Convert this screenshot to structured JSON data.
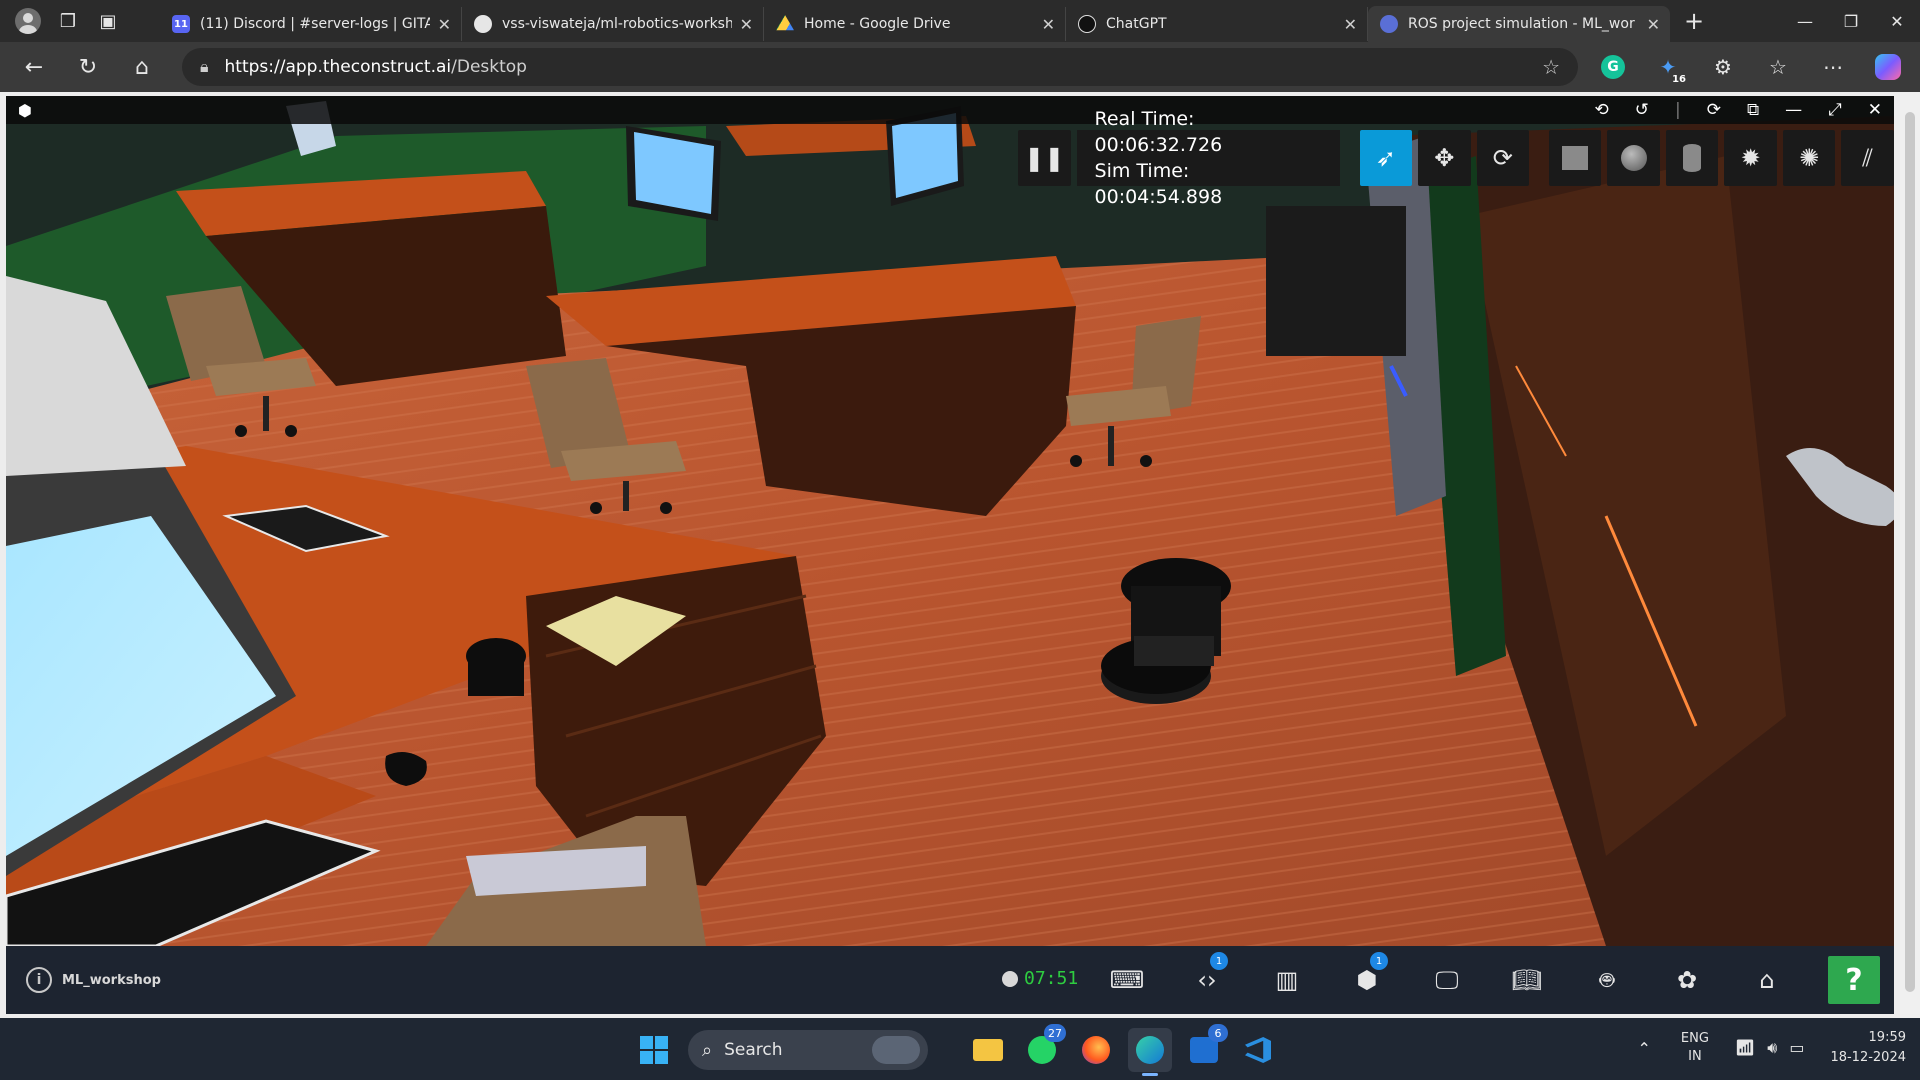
{
  "browser": {
    "tabs": [
      {
        "title": "(11) Discord | #server-logs | GITAM",
        "favicon_badge": "11",
        "active": false
      },
      {
        "title": "vss-viswateja/ml-robotics-worksh",
        "active": false
      },
      {
        "title": "Home - Google Drive",
        "active": false
      },
      {
        "title": "ChatGPT",
        "active": false
      },
      {
        "title": "ROS project simulation - ML_wor",
        "active": true
      }
    ],
    "address": {
      "host": "https://app.theconstruct.ai",
      "path": "/Desktop"
    },
    "extension_badge": "16"
  },
  "sim": {
    "real_time_label": "Real Time:",
    "real_time": "00:06:32.726",
    "sim_time_label": "Sim Time:",
    "sim_time": "00:04:54.898"
  },
  "bottombar": {
    "project_name": "ML_workshop",
    "timer": "07:51",
    "code_badge": "1",
    "sim_badge": "1",
    "help": "?"
  },
  "taskbar": {
    "search_placeholder": "Search",
    "whatsapp_count": "27",
    "outlook_count": "6",
    "lang_line1": "ENG",
    "lang_line2": "IN",
    "time": "19:59",
    "date": "18-12-2024"
  },
  "colors": {
    "accent_select": "#0a9ad8",
    "help_green": "#2ea84f",
    "timer_green": "#2ecc40",
    "floor": "#b4522e",
    "desk": "#c4501a"
  }
}
